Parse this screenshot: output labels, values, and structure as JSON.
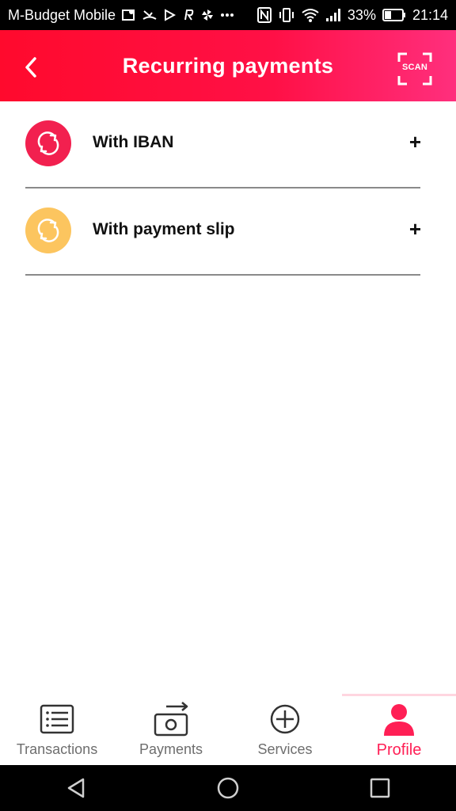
{
  "status_bar": {
    "carrier": "M-Budget Mobile",
    "battery_percent": "33%",
    "time": "21:14"
  },
  "header": {
    "title": "Recurring payments",
    "scan_label": "SCAN"
  },
  "list": {
    "items": [
      {
        "label": "With IBAN",
        "action": "+",
        "icon": "refresh-icon",
        "color": "#f2204f"
      },
      {
        "label": "With payment slip",
        "action": "+",
        "icon": "refresh-icon",
        "color": "#fcc55f"
      }
    ]
  },
  "bottom_nav": {
    "tabs": [
      {
        "label": "Transactions",
        "icon": "list-icon"
      },
      {
        "label": "Payments",
        "icon": "payment-icon"
      },
      {
        "label": "Services",
        "icon": "plus-circle-icon"
      },
      {
        "label": "Profile",
        "icon": "user-icon",
        "active": true
      }
    ]
  },
  "colors": {
    "accent": "#ff1f55",
    "header_start": "#ff0a2d",
    "header_end": "#ff2f7d"
  }
}
